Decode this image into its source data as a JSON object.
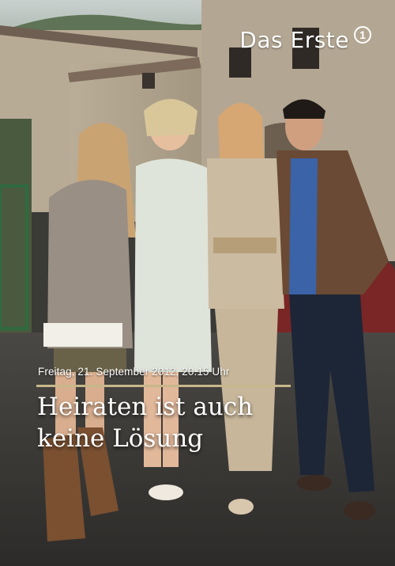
{
  "poster": {
    "channel_logo": "Das Erste",
    "airdate": "Freitag, 21. September 2012, 20.15 Uhr",
    "title_line1": "Heiraten ist auch",
    "title_line2": "keine Lösung"
  }
}
